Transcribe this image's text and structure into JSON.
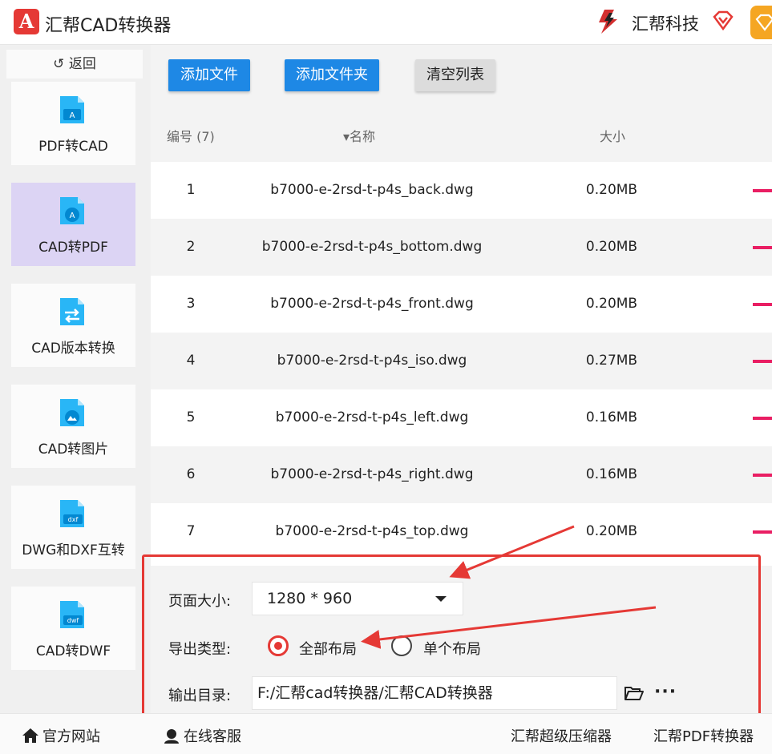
{
  "app": {
    "logo_letter": "A",
    "title": "汇帮CAD转换器"
  },
  "brand": {
    "name": "汇帮科技"
  },
  "sidebar": {
    "back_label": "↺ 返回",
    "items": [
      {
        "label": "PDF转CAD",
        "icon": "pdf-to-cad-icon",
        "active": false
      },
      {
        "label": "CAD转PDF",
        "icon": "cad-to-pdf-icon",
        "active": true
      },
      {
        "label": "CAD版本转换",
        "icon": "cad-version-icon",
        "active": false
      },
      {
        "label": "CAD转图片",
        "icon": "cad-to-image-icon",
        "active": false
      },
      {
        "label": "DWG和DXF互转",
        "icon": "dwg-dxf-icon",
        "active": false
      },
      {
        "label": "CAD转DWF",
        "icon": "cad-to-dwf-icon",
        "active": false
      }
    ]
  },
  "toolbar": {
    "add_file": "添加文件",
    "add_folder": "添加文件夹",
    "clear_list": "清空列表"
  },
  "table": {
    "headers": {
      "num": "编号 (7)",
      "name": "▾名称",
      "size": "大小"
    },
    "rows": [
      {
        "num": "1",
        "name": "b7000-e-2rsd-t-p4s_back.dwg",
        "size": "0.20MB"
      },
      {
        "num": "2",
        "name": "b7000-e-2rsd-t-p4s_bottom.dwg",
        "size": "0.20MB"
      },
      {
        "num": "3",
        "name": "b7000-e-2rsd-t-p4s_front.dwg",
        "size": "0.20MB"
      },
      {
        "num": "4",
        "name": "b7000-e-2rsd-t-p4s_iso.dwg",
        "size": "0.27MB"
      },
      {
        "num": "5",
        "name": "b7000-e-2rsd-t-p4s_left.dwg",
        "size": "0.16MB"
      },
      {
        "num": "6",
        "name": "b7000-e-2rsd-t-p4s_right.dwg",
        "size": "0.16MB"
      },
      {
        "num": "7",
        "name": "b7000-e-2rsd-t-p4s_top.dwg",
        "size": "0.20MB"
      }
    ]
  },
  "settings": {
    "page_size_label": "页面大小:",
    "page_size_value": "1280 * 960",
    "export_type_label": "导出类型:",
    "export_all": "全部布局",
    "export_single": "单个布局",
    "export_selected": "全部布局",
    "output_dir_label": "输出目录:",
    "output_dir_value": "F:/汇帮cad转换器/汇帮CAD转换器",
    "more": "···"
  },
  "footer": {
    "website": "官方网站",
    "support": "在线客服",
    "compressor": "汇帮超级压缩器",
    "pdf_converter": "汇帮PDF转换器"
  },
  "colors": {
    "accent_blue": "#1e88e5",
    "active_nav": "#dcd4f4",
    "annotation_red": "#e53935",
    "row_bar": "#e91e63",
    "orange": "#f5a623"
  }
}
